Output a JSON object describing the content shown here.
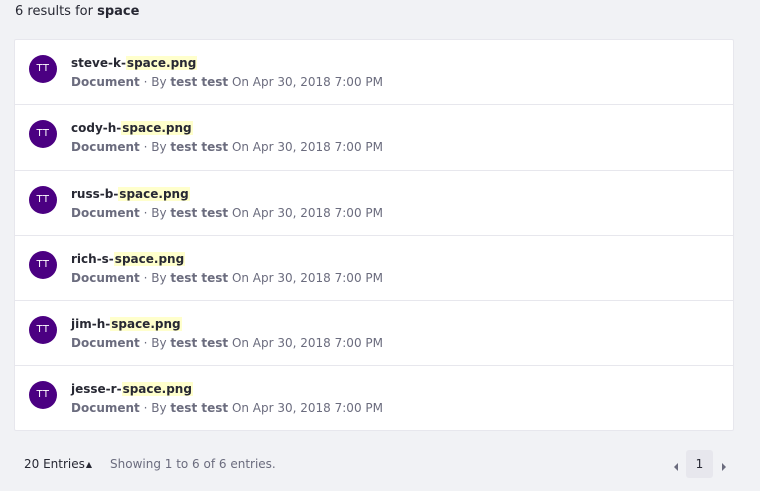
{
  "header": {
    "prefix": "6 results for",
    "keyword": "space"
  },
  "results": [
    {
      "avatar": "TT",
      "title_prefix": "steve-k-",
      "title_highlight": "space.png",
      "type": "Document",
      "by": "· By",
      "author": "test test",
      "date": "On Apr 30, 2018 7:00 PM"
    },
    {
      "avatar": "TT",
      "title_prefix": "cody-h-",
      "title_highlight": "space.png",
      "type": "Document",
      "by": "· By",
      "author": "test test",
      "date": "On Apr 30, 2018 7:00 PM"
    },
    {
      "avatar": "TT",
      "title_prefix": "russ-b-",
      "title_highlight": "space.png",
      "type": "Document",
      "by": "· By",
      "author": "test test",
      "date": "On Apr 30, 2018 7:00 PM"
    },
    {
      "avatar": "TT",
      "title_prefix": "rich-s-",
      "title_highlight": "space.png",
      "type": "Document",
      "by": "· By",
      "author": "test test",
      "date": "On Apr 30, 2018 7:00 PM"
    },
    {
      "avatar": "TT",
      "title_prefix": "jim-h-",
      "title_highlight": "space.png",
      "type": "Document",
      "by": "· By",
      "author": "test test",
      "date": "On Apr 30, 2018 7:00 PM"
    },
    {
      "avatar": "TT",
      "title_prefix": "jesse-r-",
      "title_highlight": "space.png",
      "type": "Document",
      "by": "· By",
      "author": "test test",
      "date": "On Apr 30, 2018 7:00 PM"
    }
  ],
  "footer": {
    "entries_label": "20 Entries",
    "entries_caret_icon": "sort-caret-icon",
    "showing": "Showing 1 to 6 of 6 entries.",
    "prev_icon": "chevron-left-icon",
    "next_icon": "chevron-right-icon",
    "current_page": "1"
  },
  "colors": {
    "avatar_bg": "#4b0082",
    "highlight": "#ffffcc",
    "page_bg": "#f1f2f5",
    "card_bg": "#ffffff",
    "muted_text": "#6b6c7e"
  }
}
